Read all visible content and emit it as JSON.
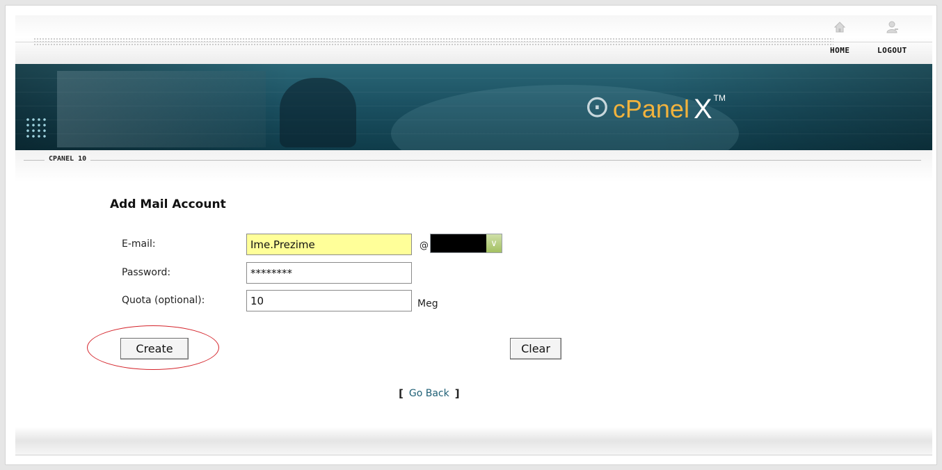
{
  "header": {
    "nav": [
      {
        "label": "HOME",
        "icon": "home-icon"
      },
      {
        "label": "LOGOUT",
        "icon": "logout-icon"
      }
    ]
  },
  "banner": {
    "logo_text": "cPanel",
    "logo_x": "X",
    "logo_tm": "TM"
  },
  "breadcrumb": {
    "label": "CPANEL 10"
  },
  "form": {
    "title": "Add Mail Account",
    "email_label": "E-mail:",
    "email_value": "Ime.Prezime",
    "at_sign": "@",
    "password_label": "Password:",
    "password_value": "********",
    "quota_label": "Quota (optional):",
    "quota_value": "10",
    "quota_unit": "Meg",
    "create_label": "Create",
    "clear_label": "Clear"
  },
  "nav_back": {
    "open": "[",
    "label": "Go Back",
    "close": "]"
  },
  "colors": {
    "banner": "#1a4f60",
    "logo_accent": "#f2b33d",
    "email_highlight": "#ffff99",
    "annotation": "#d4232a",
    "link": "#1e5f75"
  }
}
